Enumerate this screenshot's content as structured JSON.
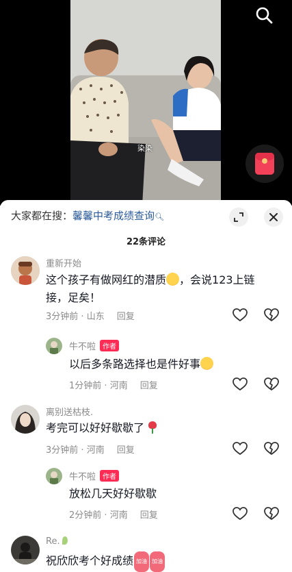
{
  "video": {
    "caption": "染染"
  },
  "sheet": {
    "hot_search_prefix": "大家都在搜：",
    "hot_search_term": "馨馨中考成绩查询",
    "comment_count": "22条评论"
  },
  "comments": [
    {
      "nickname": "重新开始",
      "text_1": "这个孩子有做网红的潜质",
      "text_2": "，会说123上链",
      "text_3": "接，足矣！",
      "time": "3分钟前",
      "location": "山东",
      "reply_label": "回复"
    },
    {
      "nickname": "牛不啦",
      "author_tag": "作者",
      "text": "以后多条路选择也是件好事",
      "time": "1分钟前",
      "location": "河南",
      "reply_label": "回复"
    },
    {
      "nickname": "离别送枯枝.",
      "text": "考完可以好好歇歇了",
      "time": "3分钟前",
      "location": "河南",
      "reply_label": "回复"
    },
    {
      "nickname": "牛不啦",
      "author_tag": "作者",
      "text": "放松几天好好歇歇",
      "time": "2分钟前",
      "location": "河南",
      "reply_label": "回复"
    },
    {
      "nickname": "Re.",
      "text": "祝欣欣考个好成绩",
      "badge_1": "加油",
      "badge_2": "加油"
    }
  ],
  "icons": {
    "search": "search-icon",
    "red_packet": "red-packet-icon",
    "expand": "expand-icon",
    "close": "close-icon",
    "like": "heart-outline-icon",
    "dislike": "broken-heart-icon"
  },
  "colors": {
    "accent": "#fe2c55",
    "link": "#2a5a99",
    "meta": "#8a8a8a"
  }
}
